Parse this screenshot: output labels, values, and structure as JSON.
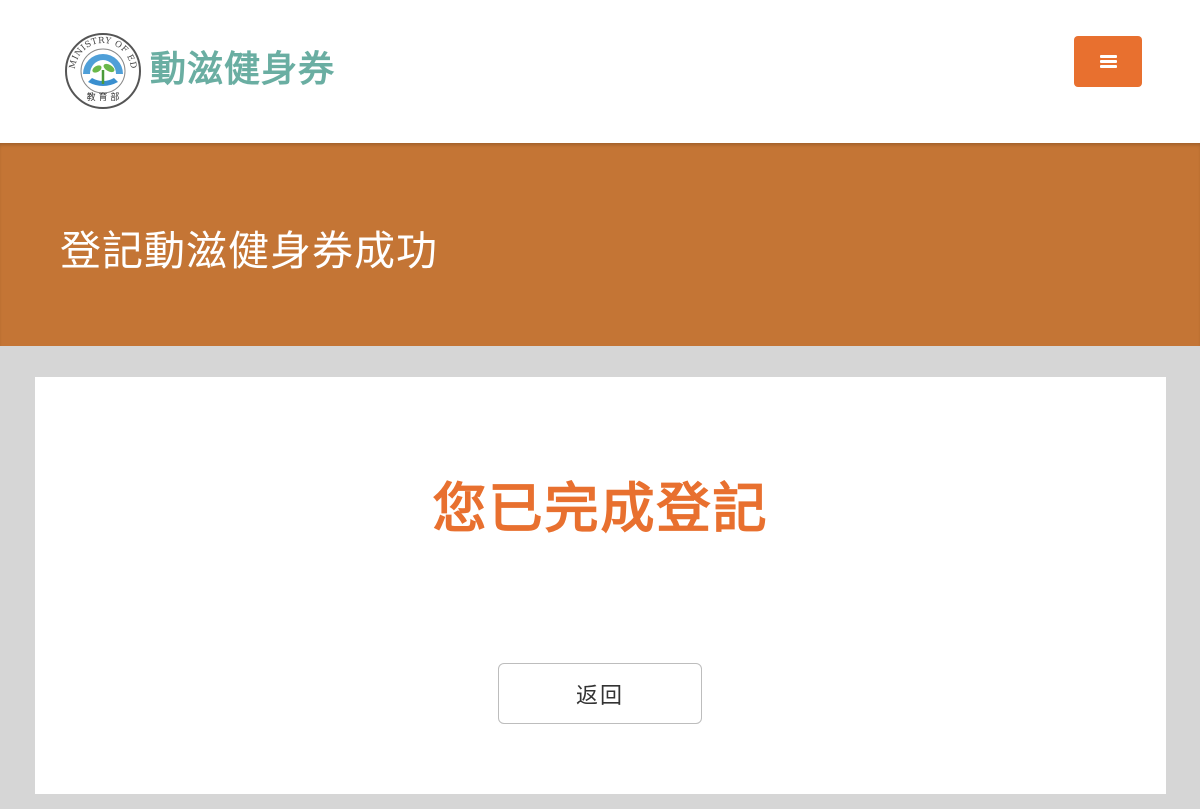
{
  "header": {
    "seal_text": "MINISTRY OF EDUCATION 教育部",
    "site_name": "動滋健身券",
    "menu_button_label": "menu"
  },
  "banner": {
    "title": "登記動滋健身券成功"
  },
  "card": {
    "message": "您已完成登記",
    "back_button_label": "返回"
  },
  "colors": {
    "brand_green": "#6aaea2",
    "accent_orange": "#e8702f",
    "banner_brown": "#c47535",
    "page_gray": "#d6d6d6"
  },
  "icons": {
    "seal": "ministry-of-education-seal",
    "menu": "hamburger-icon"
  }
}
